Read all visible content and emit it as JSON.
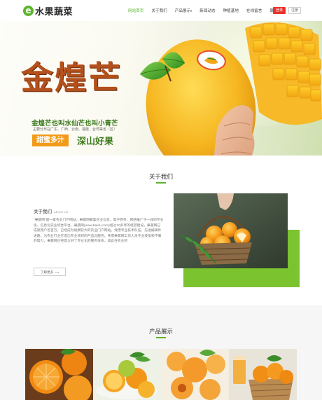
{
  "header": {
    "logo_letter": "e",
    "logo_text": "水果蔬菜",
    "nav": [
      {
        "label": "网站首页",
        "active": true
      },
      {
        "label": "关于我们",
        "active": false
      },
      {
        "label": "产品展示",
        "active": false,
        "dropdown": true
      },
      {
        "label": "新闻动态",
        "active": false
      },
      {
        "label": "种植基地",
        "active": false
      },
      {
        "label": "在线留言",
        "active": false
      },
      {
        "label": "联系我们",
        "active": false
      }
    ],
    "nav_dropdown_glyph": "▾",
    "login_label": "登录",
    "register_label": "注册"
  },
  "banner": {
    "title": "金煌芒",
    "subtitle": "金煌芒也叫水仙芒也叫小青芒",
    "origin": "主要分布在广东、广西、云南、福建、台湾等省（区）",
    "tag": "甜蜜多汁",
    "tag2": "深山好果",
    "slide_count": 3,
    "active_slide": 1
  },
  "about": {
    "section_title": "关于我们",
    "heading": "关于我们",
    "heading_en": "ABOUT US",
    "body": "“果蔬网”是一家农业门户网站，果蔬网聚集农业信息、电子商务、网络推广于一体的专业化、信息化农业综合平台。果蔬网(www.baidu.com)经过10多年的经营建设，果蔬网已成就用户近百万，已经成为规模较大的农业门户网站。凭借专业技术队伍、先进编辑件进路，为农业行业打造出专业领到的产品与服务。凭借果蔬网工作人员专业技能和不懈的努力，果蔬网已经建立好了专业化的服务体系，如此在农业的",
    "more_label": "了解更多",
    "more_arrow": "⟶"
  },
  "products": {
    "section_title": "产品展示"
  },
  "colors": {
    "brand_green": "#5bb52d",
    "login_red": "#e8322b",
    "tag_orange": "#f29a1a",
    "title_brown": "#b3501c"
  }
}
